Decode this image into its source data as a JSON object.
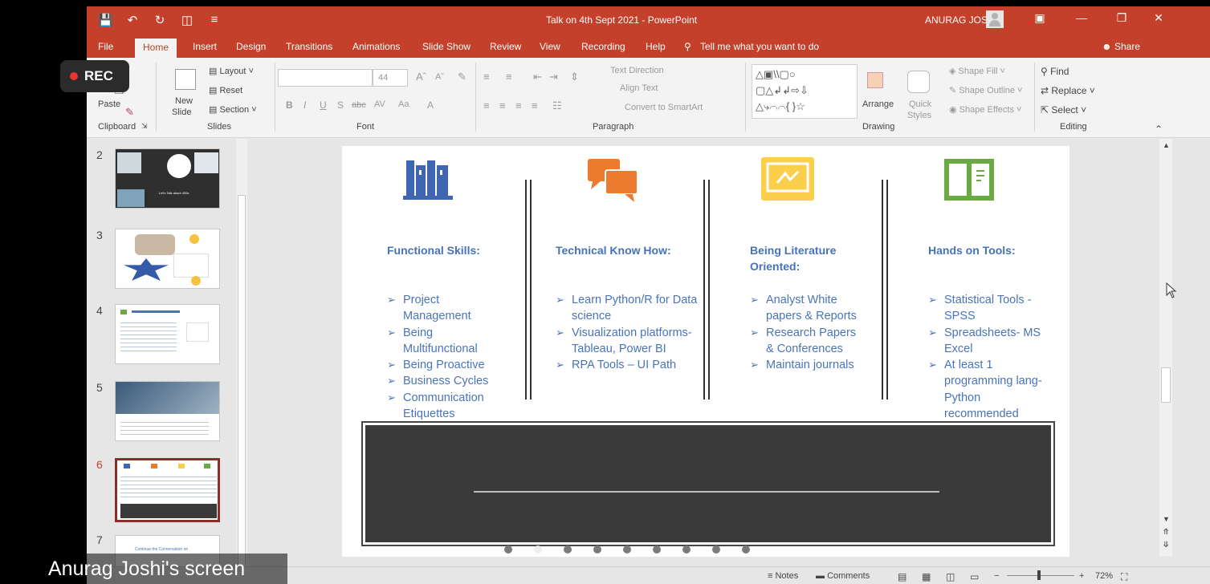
{
  "window": {
    "title": "Talk on 4th Sept 2021  -  PowerPoint",
    "user": "ANURAG JOSHI",
    "qat_icons": [
      "save-icon",
      "undo-icon",
      "redo-icon",
      "present-icon",
      "customize-icon"
    ]
  },
  "tabs": [
    "File",
    "Home",
    "Insert",
    "Design",
    "Transitions",
    "Animations",
    "Slide Show",
    "Review",
    "View",
    "Recording",
    "Help"
  ],
  "active_tab": "Home",
  "tell_me": "Tell me what you want to do",
  "share": "Share",
  "recording": {
    "label": "REC"
  },
  "ribbon": {
    "clipboard": {
      "paste": "Paste",
      "label": "Clipboard"
    },
    "slides": {
      "new_slide_1": "New",
      "new_slide_2": "Slide",
      "layout": "Layout",
      "reset": "Reset",
      "section": "Section",
      "label": "Slides"
    },
    "font": {
      "size": "44",
      "label": "Font",
      "bold": "B",
      "italic": "I",
      "underline": "U",
      "shadow": "S",
      "strike": "abc",
      "case": "Aa"
    },
    "paragraph": {
      "text_direction": "Text Direction",
      "align_text": "Align Text",
      "convert_smartart": "Convert to SmartArt",
      "label": "Paragraph"
    },
    "drawing": {
      "arrange": "Arrange",
      "quick_styles_1": "Quick",
      "quick_styles_2": "Styles",
      "shape_fill": "Shape Fill",
      "shape_outline": "Shape Outline",
      "shape_effects": "Shape Effects",
      "label": "Drawing"
    },
    "editing": {
      "find": "Find",
      "replace": "Replace",
      "select": "Select",
      "label": "Editing"
    }
  },
  "thumbnails": [
    {
      "num": "2",
      "text": "Let's Talk about 400s"
    },
    {
      "num": "3",
      "text": ""
    },
    {
      "num": "4",
      "text": ""
    },
    {
      "num": "5",
      "text": ""
    },
    {
      "num": "6",
      "text": ""
    },
    {
      "num": "7",
      "text": "Continue the Conversation on"
    }
  ],
  "slide": {
    "columns": [
      {
        "title": "Functional Skills:",
        "items": [
          "Project Management",
          "Being Multifunctional",
          "Being Proactive",
          "Business Cycles",
          "Communication Etiquettes"
        ],
        "color": "#3f67b1",
        "icon": "books-icon"
      },
      {
        "title": "Technical Know How:",
        "items": [
          "Learn Python/R for Data science",
          "Visualization platforms- Tableau, Power BI",
          "RPA Tools – UI Path"
        ],
        "color": "#ec7b30",
        "icon": "chat-bubbles-icon"
      },
      {
        "title": "Being Literature Oriented:",
        "items": [
          "Analyst White papers & Reports",
          "Research Papers & Conferences",
          "Maintain journals"
        ],
        "color": "#fbcf4b",
        "icon": "presentation-board-icon"
      },
      {
        "title": "Hands on Tools:",
        "items": [
          "Statistical Tools - SPSS",
          "Spreadsheets- MS Excel",
          "At least 1 programming lang- Python recommended"
        ],
        "color": "#6ba943",
        "icon": "open-book-icon"
      }
    ],
    "carousel_dots": 10
  },
  "status": {
    "notes": "Notes",
    "comments": "Comments",
    "zoom": "72%"
  },
  "screen_share_label": "Anurag Joshi's screen",
  "colors": {
    "accent": "#c4402a",
    "slide_text": "#4a74b9"
  }
}
